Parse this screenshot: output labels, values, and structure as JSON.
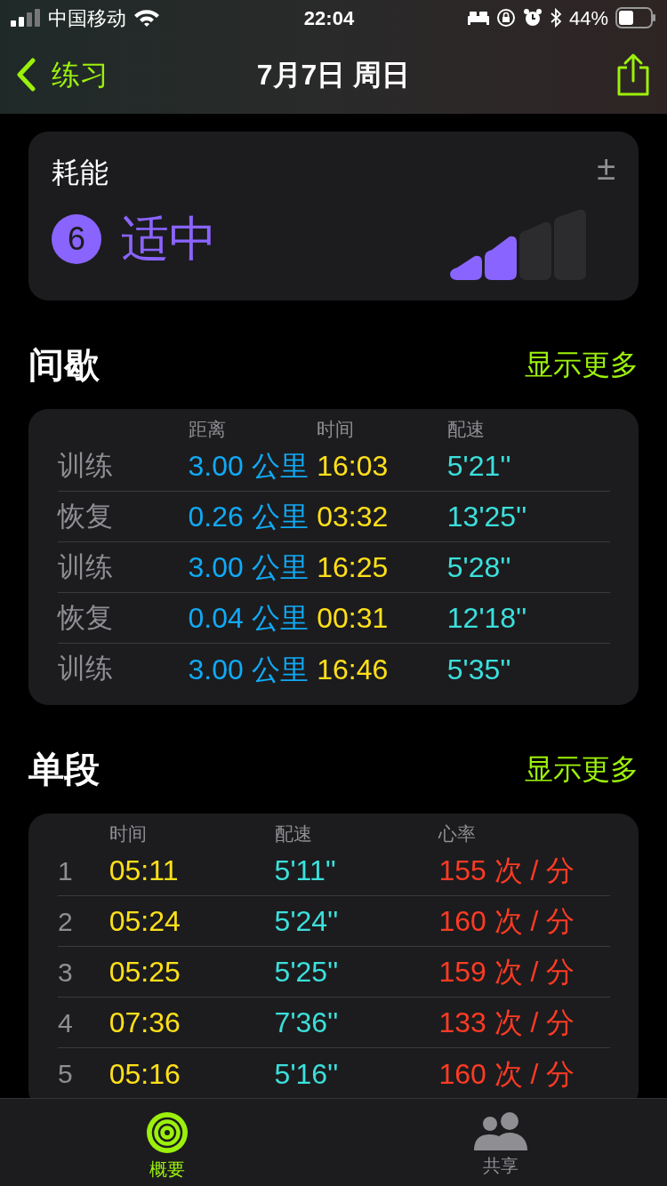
{
  "status_bar": {
    "carrier": "中国移动",
    "time": "22:04",
    "battery": "44%"
  },
  "nav": {
    "back": "练习",
    "title": "7月7日 周日"
  },
  "effort": {
    "title": "耗能",
    "adjust": "±",
    "score": "6",
    "label": "适中",
    "level": 0.5
  },
  "intervals": {
    "title": "间歇",
    "more": "显示更多",
    "columns": [
      "距离",
      "时间",
      "配速"
    ],
    "rows": [
      {
        "type": "训练",
        "distance": "3.00 公里",
        "time": "16:03",
        "pace": "5'21''"
      },
      {
        "type": "恢复",
        "distance": "0.26 公里",
        "time": "03:32",
        "pace": "13'25''"
      },
      {
        "type": "训练",
        "distance": "3.00 公里",
        "time": "16:25",
        "pace": "5'28''"
      },
      {
        "type": "恢复",
        "distance": "0.04 公里",
        "time": "00:31",
        "pace": "12'18''"
      },
      {
        "type": "训练",
        "distance": "3.00 公里",
        "time": "16:46",
        "pace": "5'35''"
      }
    ]
  },
  "splits": {
    "title": "单段",
    "more": "显示更多",
    "columns": [
      "时间",
      "配速",
      "心率"
    ],
    "rows": [
      {
        "index": "1",
        "time": "05:11",
        "pace": "5'11''",
        "heart_rate": "155 次 / 分"
      },
      {
        "index": "2",
        "time": "05:24",
        "pace": "5'24''",
        "heart_rate": "160 次 / 分"
      },
      {
        "index": "3",
        "time": "05:25",
        "pace": "5'25''",
        "heart_rate": "159 次 / 分"
      },
      {
        "index": "4",
        "time": "07:36",
        "pace": "7'36''",
        "heart_rate": "133 次 / 分"
      },
      {
        "index": "5",
        "time": "05:16",
        "pace": "5'16''",
        "heart_rate": "160 次 / 分"
      }
    ]
  },
  "tab_bar": [
    {
      "label": "概要",
      "selected": true
    },
    {
      "label": "共享",
      "selected": false
    }
  ]
}
